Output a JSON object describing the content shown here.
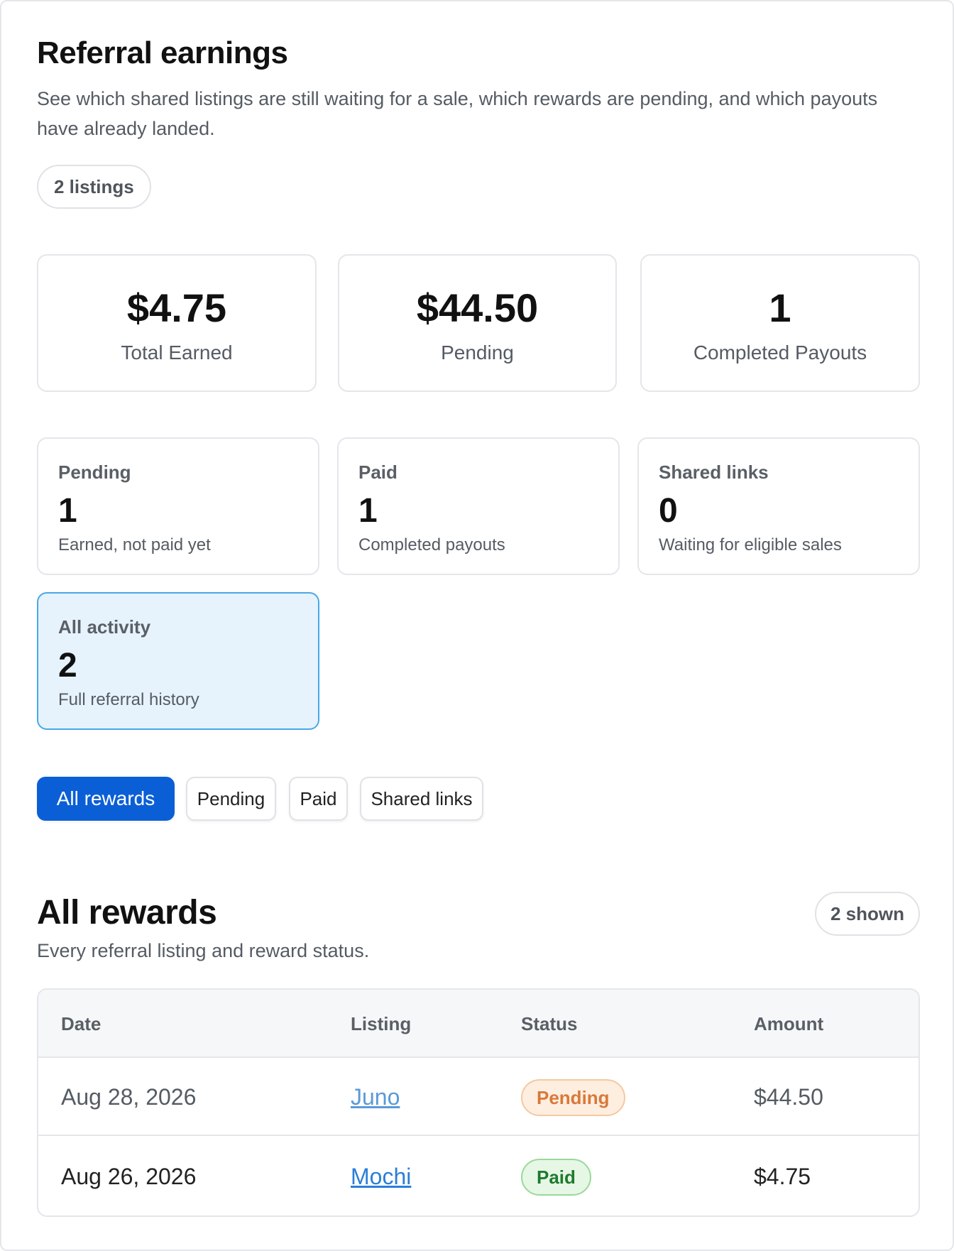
{
  "header": {
    "title": "Referral earnings",
    "description": "See which shared listings are still waiting for a sale, which rewards are pending, and which payouts have already landed.",
    "listings_count": "2 listings"
  },
  "stats": [
    {
      "value": "$4.75",
      "label": "Total Earned"
    },
    {
      "value": "$44.50",
      "label": "Pending"
    },
    {
      "value": "1",
      "label": "Completed Payouts"
    }
  ],
  "cards": [
    {
      "title": "Pending",
      "value": "1",
      "sub": "Earned, not paid yet"
    },
    {
      "title": "Paid",
      "value": "1",
      "sub": "Completed payouts"
    },
    {
      "title": "Shared links",
      "value": "0",
      "sub": "Waiting for eligible sales"
    },
    {
      "title": "All activity",
      "value": "2",
      "sub": "Full referral history"
    }
  ],
  "filters": [
    "All rewards",
    "Pending",
    "Paid",
    "Shared links"
  ],
  "section": {
    "title": "All rewards",
    "description": "Every referral listing and reward status.",
    "shown": "2 shown"
  },
  "table": {
    "headers": [
      "Date",
      "Listing",
      "Status",
      "Amount"
    ],
    "rows": [
      {
        "date": "Aug 28, 2026",
        "listing": "Juno",
        "status": "Pending",
        "amount": "$44.50"
      },
      {
        "date": "Aug 26, 2026",
        "listing": "Mochi",
        "status": "Paid",
        "amount": "$4.75"
      }
    ]
  },
  "colors": {
    "accent": "#0b5fd6",
    "active_card_bg": "#e6f3fc",
    "pending": "#d9793a",
    "paid": "#1f7a2e",
    "link": "#2a7fd6"
  }
}
